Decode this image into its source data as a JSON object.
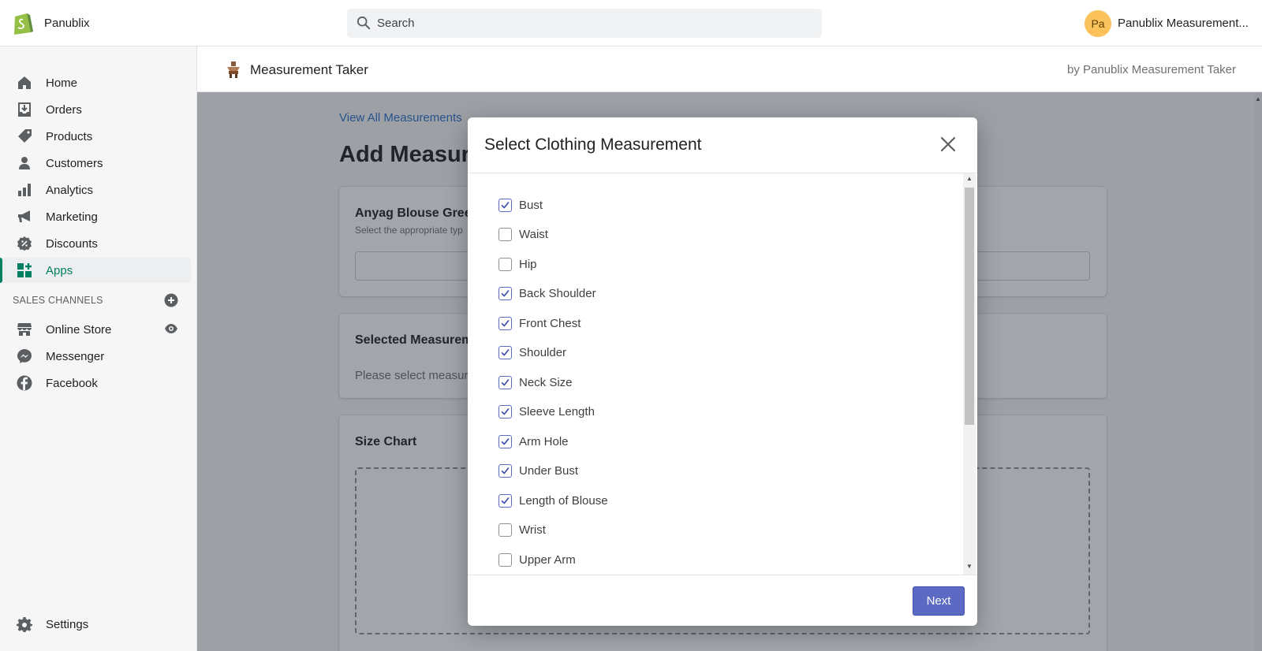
{
  "topbar": {
    "shop_name": "Panublix",
    "search_placeholder": "Search",
    "avatar_initials": "Pa",
    "account_name": "Panublix Measurement..."
  },
  "sidebar": {
    "items": [
      {
        "label": "Home",
        "icon": "home-icon"
      },
      {
        "label": "Orders",
        "icon": "orders-icon"
      },
      {
        "label": "Products",
        "icon": "tag-icon"
      },
      {
        "label": "Customers",
        "icon": "person-icon"
      },
      {
        "label": "Analytics",
        "icon": "bar-chart-icon"
      },
      {
        "label": "Marketing",
        "icon": "megaphone-icon"
      },
      {
        "label": "Discounts",
        "icon": "discount-icon"
      },
      {
        "label": "Apps",
        "icon": "apps-icon",
        "active": true
      }
    ],
    "sales_channels_heading": "SALES CHANNELS",
    "channels": [
      {
        "label": "Online Store",
        "icon": "store-icon"
      },
      {
        "label": "Messenger",
        "icon": "messenger-icon"
      },
      {
        "label": "Facebook",
        "icon": "facebook-icon"
      }
    ],
    "settings_label": "Settings"
  },
  "app_header": {
    "title": "Measurement Taker",
    "by": "by Panublix Measurement Taker"
  },
  "page": {
    "back_link": "View All Measurements",
    "title": "Add Measure",
    "card1_title": "Anyag Blouse Gree",
    "card1_sub": "Select the appropriate typ",
    "card2_title": "Selected Measurem",
    "card2_text": "Please select measurer",
    "card3_title": "Size Chart"
  },
  "modal": {
    "title": "Select Clothing Measurement",
    "items": [
      {
        "label": "Bust",
        "checked": true
      },
      {
        "label": "Waist",
        "checked": false
      },
      {
        "label": "Hip",
        "checked": false
      },
      {
        "label": "Back Shoulder",
        "checked": true
      },
      {
        "label": "Front Chest",
        "checked": true
      },
      {
        "label": "Shoulder",
        "checked": true
      },
      {
        "label": "Neck Size",
        "checked": true
      },
      {
        "label": "Sleeve Length",
        "checked": true
      },
      {
        "label": "Arm Hole",
        "checked": true
      },
      {
        "label": "Under Bust",
        "checked": true
      },
      {
        "label": "Length of Blouse",
        "checked": true
      },
      {
        "label": "Wrist",
        "checked": false
      },
      {
        "label": "Upper Arm",
        "checked": false
      }
    ],
    "next_label": "Next"
  },
  "colors": {
    "accent_green": "#008060",
    "primary_button": "#5c6ac4",
    "link": "#2c6ecb"
  }
}
